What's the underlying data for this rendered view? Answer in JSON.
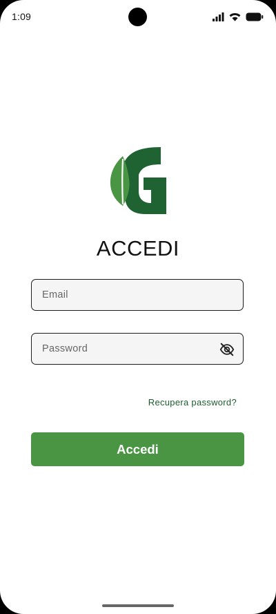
{
  "status_bar": {
    "time": "1:09",
    "icons": [
      "signal-icon",
      "wifi-icon",
      "battery-icon"
    ]
  },
  "logo": {
    "icon": "leaf-g-logo",
    "colors": {
      "leaf": "#4a9544",
      "letter": "#1f6332"
    }
  },
  "title": "ACCEDI",
  "form": {
    "email_placeholder": "Email",
    "email_value": "",
    "password_placeholder": "Password",
    "password_value": "",
    "toggle_visibility_icon": "eye-off-icon",
    "recover_label": "Recupera password?",
    "submit_label": "Accedi"
  },
  "colors": {
    "primary": "#4a9544",
    "link": "#1d5b2e",
    "field_bg": "#f5f5f5"
  }
}
